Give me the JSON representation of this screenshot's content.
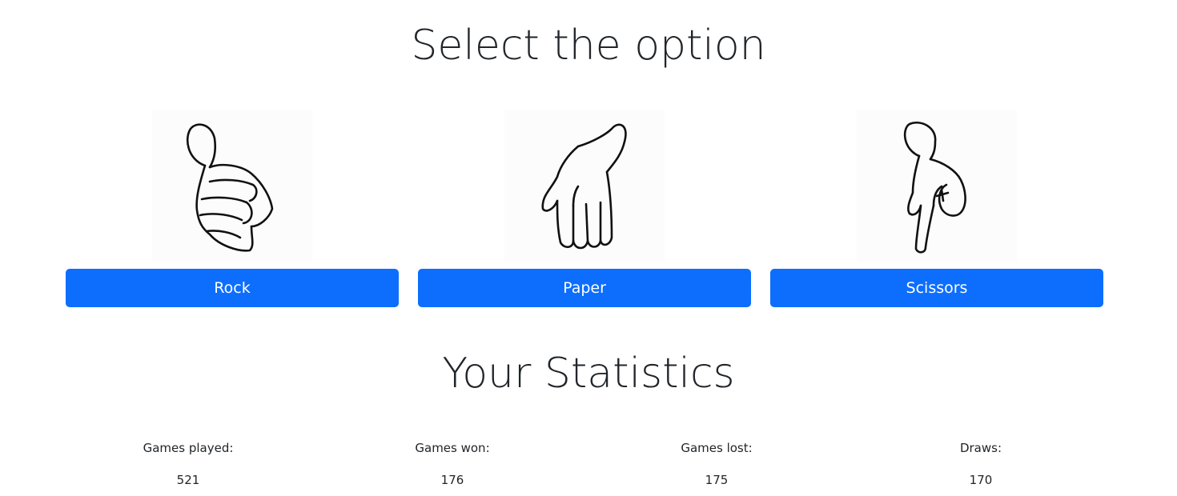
{
  "select_heading": "Select the option",
  "options": [
    {
      "label": "Rock",
      "icon": "rock-hand-icon"
    },
    {
      "label": "Paper",
      "icon": "paper-hand-icon"
    },
    {
      "label": "Scissors",
      "icon": "scissors-hand-icon"
    }
  ],
  "stats_heading": "Your Statistics",
  "stats": [
    {
      "label": "Games played:",
      "value": "521"
    },
    {
      "label": "Games won:",
      "value": "176"
    },
    {
      "label": "Games lost:",
      "value": "175"
    },
    {
      "label": "Draws:",
      "value": "170"
    }
  ],
  "colors": {
    "button_bg": "#0d6efd",
    "button_text": "#ffffff",
    "text": "#212529"
  }
}
